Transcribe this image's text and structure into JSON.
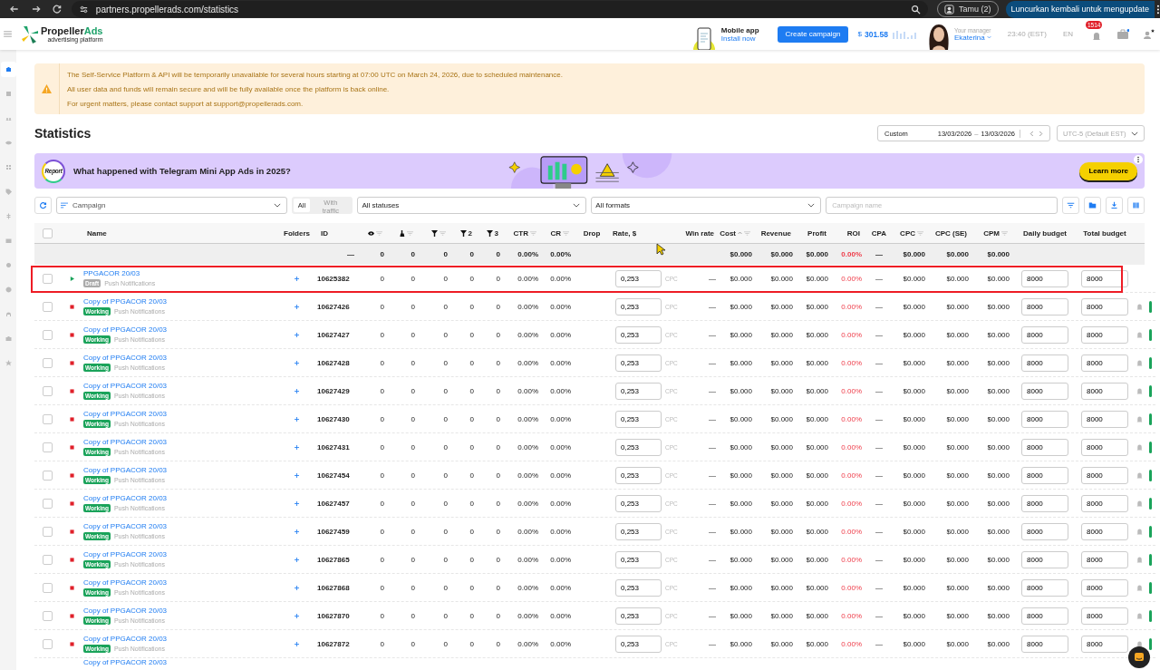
{
  "browser": {
    "url": "partners.propellerads.com/statistics",
    "profile": "Tamu (2)",
    "update_button": "Luncurkan kembali untuk mengupdate"
  },
  "header": {
    "logo_main": "Propeller",
    "logo_accent": "Ads",
    "logo_tagline": "advertising platform",
    "mobile_app_title": "Mobile app",
    "mobile_app_link": "Install now",
    "create_button": "Create campaign",
    "balance_currency": "$",
    "balance": "301.58",
    "manager_label": "Your manager",
    "manager_name": "Ekaterina",
    "time": "23:40 (EST)",
    "language": "EN",
    "notifications": "1514"
  },
  "sidebar": [
    {
      "selected": true
    },
    {
      "selected": false
    },
    {
      "selected": false
    },
    {
      "selected": false
    },
    {
      "selected": false
    },
    {
      "selected": false
    },
    {
      "selected": false
    },
    {
      "selected": false
    },
    {
      "selected": false
    },
    {
      "selected": false
    },
    {
      "selected": false
    },
    {
      "selected": false
    },
    {
      "selected": false
    }
  ],
  "notice": {
    "lines": [
      "The Self-Service Platform & API will be temporarily unavailable for several hours starting at 07:00 UTC on March 24, 2026, due to scheduled maintenance.",
      "All user data and funds will remain secure and will be fully available once the platform is back online.",
      "For urgent matters, please contact support at support@propellerads.com."
    ]
  },
  "page_title": "Statistics",
  "date_range": {
    "preset": "Custom",
    "from": "13/03/2026",
    "separator": "–",
    "to": "13/03/2026"
  },
  "timezone": "UTC-5 (Default EST)",
  "promo": {
    "badge": "Report",
    "title": "What happened with Telegram Mini App Ads in 2025?",
    "button": "Learn more"
  },
  "filters": {
    "grouping": "Campaign",
    "traffic": [
      {
        "label": "All",
        "selected": true
      },
      {
        "label": "With traffic",
        "selected": false
      }
    ],
    "status": "All statuses",
    "formats": "All formats",
    "search_placeholder": "Campaign name"
  },
  "table": {
    "select_all": {
      "checked": false
    },
    "columns": [
      {
        "label": "Name",
        "filter": false,
        "sorted": false
      },
      {
        "label": "Folders",
        "filter": false,
        "sorted": false
      },
      {
        "label": "ID",
        "filter": false,
        "sorted": false
      },
      {
        "filter": true,
        "sorted": false
      },
      {
        "filter": true,
        "sorted": false
      },
      {
        "filter": true,
        "sorted": false
      },
      {
        "label": "2",
        "filter": false,
        "sorted": false
      },
      {
        "label": "3",
        "filter": false,
        "sorted": false
      },
      {
        "label": "CTR",
        "filter": true,
        "sorted": false
      },
      {
        "label": "CR",
        "filter": true,
        "sorted": false
      },
      {
        "label": "Drop",
        "filter": false,
        "sorted": false
      },
      {
        "label": "Rate, $",
        "filter": false,
        "sorted": false
      },
      {
        "label": "Win rate",
        "filter": false,
        "sorted": false
      },
      {
        "label": "Cost",
        "filter": true,
        "sorted": true
      },
      {
        "label": "Revenue",
        "filter": false,
        "sorted": false
      },
      {
        "label": "Profit",
        "filter": false,
        "sorted": false
      },
      {
        "label": "ROI",
        "filter": false,
        "sorted": false
      },
      {
        "label": "CPA",
        "filter": false,
        "sorted": false
      },
      {
        "label": "CPC",
        "filter": true,
        "sorted": false
      },
      {
        "label": "CPC (SE)",
        "filter": false,
        "sorted": false
      },
      {
        "label": "CPM",
        "filter": true,
        "sorted": false
      },
      {
        "label": "Daily budget",
        "filter": false,
        "sorted": false
      },
      {
        "label": "Total budget",
        "filter": false,
        "sorted": false
      }
    ],
    "totals": {
      "id": "—",
      "metrics": [
        "0",
        "0",
        "0",
        "0",
        "0",
        "0.00%",
        "0.00%"
      ],
      "money": [
        "$0.000",
        "$0.000",
        "$0.000"
      ],
      "roi": "0.00%",
      "cpa": "—",
      "cpc": [
        "$0.000",
        "$0.000",
        "$0.000"
      ]
    },
    "rows": [
      {
        "kind": "draft",
        "checked": false,
        "highlighted": true,
        "name": "PPGACOR 20/03",
        "badge": "Draft",
        "format": "Push Notifications",
        "id": "10625382",
        "metrics": [
          "0",
          "0",
          "0",
          "0",
          "0",
          "0.00%",
          "0.00%"
        ],
        "rate": "0,253",
        "rate_unit": "CPC",
        "win_rate": "—",
        "money": [
          "$0.000",
          "$0.000",
          "$0.000"
        ],
        "roi": "0.00%",
        "cpa": "—",
        "cpc": [
          "$0.000",
          "$0.000",
          "$0.000"
        ],
        "daily_budget": "8000",
        "total_budget": "8000"
      },
      {
        "kind": "working",
        "checked": false,
        "highlighted": false,
        "name": "Copy of PPGACOR 20/03",
        "badge": "Working",
        "format": "Push Notifications",
        "id": "10627426",
        "metrics": [
          "0",
          "0",
          "0",
          "0",
          "0",
          "0.00%",
          "0.00%"
        ],
        "rate": "0,253",
        "rate_unit": "CPC",
        "win_rate": "—",
        "money": [
          "$0.000",
          "$0.000",
          "$0.000"
        ],
        "roi": "0.00%",
        "cpa": "—",
        "cpc": [
          "$0.000",
          "$0.000",
          "$0.000"
        ],
        "daily_budget": "8000",
        "total_budget": "8000"
      },
      {
        "kind": "working",
        "checked": false,
        "highlighted": false,
        "name": "Copy of PPGACOR 20/03",
        "badge": "Working",
        "format": "Push Notifications",
        "id": "10627427",
        "metrics": [
          "0",
          "0",
          "0",
          "0",
          "0",
          "0.00%",
          "0.00%"
        ],
        "rate": "0,253",
        "rate_unit": "CPC",
        "win_rate": "—",
        "money": [
          "$0.000",
          "$0.000",
          "$0.000"
        ],
        "roi": "0.00%",
        "cpa": "—",
        "cpc": [
          "$0.000",
          "$0.000",
          "$0.000"
        ],
        "daily_budget": "8000",
        "total_budget": "8000"
      },
      {
        "kind": "working",
        "checked": false,
        "highlighted": false,
        "name": "Copy of PPGACOR 20/03",
        "badge": "Working",
        "format": "Push Notifications",
        "id": "10627428",
        "metrics": [
          "0",
          "0",
          "0",
          "0",
          "0",
          "0.00%",
          "0.00%"
        ],
        "rate": "0,253",
        "rate_unit": "CPC",
        "win_rate": "—",
        "money": [
          "$0.000",
          "$0.000",
          "$0.000"
        ],
        "roi": "0.00%",
        "cpa": "—",
        "cpc": [
          "$0.000",
          "$0.000",
          "$0.000"
        ],
        "daily_budget": "8000",
        "total_budget": "8000"
      },
      {
        "kind": "working",
        "checked": false,
        "highlighted": false,
        "name": "Copy of PPGACOR 20/03",
        "badge": "Working",
        "format": "Push Notifications",
        "id": "10627429",
        "metrics": [
          "0",
          "0",
          "0",
          "0",
          "0",
          "0.00%",
          "0.00%"
        ],
        "rate": "0,253",
        "rate_unit": "CPC",
        "win_rate": "—",
        "money": [
          "$0.000",
          "$0.000",
          "$0.000"
        ],
        "roi": "0.00%",
        "cpa": "—",
        "cpc": [
          "$0.000",
          "$0.000",
          "$0.000"
        ],
        "daily_budget": "8000",
        "total_budget": "8000"
      },
      {
        "kind": "working",
        "checked": false,
        "highlighted": false,
        "name": "Copy of PPGACOR 20/03",
        "badge": "Working",
        "format": "Push Notifications",
        "id": "10627430",
        "metrics": [
          "0",
          "0",
          "0",
          "0",
          "0",
          "0.00%",
          "0.00%"
        ],
        "rate": "0,253",
        "rate_unit": "CPC",
        "win_rate": "—",
        "money": [
          "$0.000",
          "$0.000",
          "$0.000"
        ],
        "roi": "0.00%",
        "cpa": "—",
        "cpc": [
          "$0.000",
          "$0.000",
          "$0.000"
        ],
        "daily_budget": "8000",
        "total_budget": "8000"
      },
      {
        "kind": "working",
        "checked": false,
        "highlighted": false,
        "name": "Copy of PPGACOR 20/03",
        "badge": "Working",
        "format": "Push Notifications",
        "id": "10627431",
        "metrics": [
          "0",
          "0",
          "0",
          "0",
          "0",
          "0.00%",
          "0.00%"
        ],
        "rate": "0,253",
        "rate_unit": "CPC",
        "win_rate": "—",
        "money": [
          "$0.000",
          "$0.000",
          "$0.000"
        ],
        "roi": "0.00%",
        "cpa": "—",
        "cpc": [
          "$0.000",
          "$0.000",
          "$0.000"
        ],
        "daily_budget": "8000",
        "total_budget": "8000"
      },
      {
        "kind": "working",
        "checked": false,
        "highlighted": false,
        "name": "Copy of PPGACOR 20/03",
        "badge": "Working",
        "format": "Push Notifications",
        "id": "10627454",
        "metrics": [
          "0",
          "0",
          "0",
          "0",
          "0",
          "0.00%",
          "0.00%"
        ],
        "rate": "0,253",
        "rate_unit": "CPC",
        "win_rate": "—",
        "money": [
          "$0.000",
          "$0.000",
          "$0.000"
        ],
        "roi": "0.00%",
        "cpa": "—",
        "cpc": [
          "$0.000",
          "$0.000",
          "$0.000"
        ],
        "daily_budget": "8000",
        "total_budget": "8000"
      },
      {
        "kind": "working",
        "checked": false,
        "highlighted": false,
        "name": "Copy of PPGACOR 20/03",
        "badge": "Working",
        "format": "Push Notifications",
        "id": "10627457",
        "metrics": [
          "0",
          "0",
          "0",
          "0",
          "0",
          "0.00%",
          "0.00%"
        ],
        "rate": "0,253",
        "rate_unit": "CPC",
        "win_rate": "—",
        "money": [
          "$0.000",
          "$0.000",
          "$0.000"
        ],
        "roi": "0.00%",
        "cpa": "—",
        "cpc": [
          "$0.000",
          "$0.000",
          "$0.000"
        ],
        "daily_budget": "8000",
        "total_budget": "8000"
      },
      {
        "kind": "working",
        "checked": false,
        "highlighted": false,
        "name": "Copy of PPGACOR 20/03",
        "badge": "Working",
        "format": "Push Notifications",
        "id": "10627459",
        "metrics": [
          "0",
          "0",
          "0",
          "0",
          "0",
          "0.00%",
          "0.00%"
        ],
        "rate": "0,253",
        "rate_unit": "CPC",
        "win_rate": "—",
        "money": [
          "$0.000",
          "$0.000",
          "$0.000"
        ],
        "roi": "0.00%",
        "cpa": "—",
        "cpc": [
          "$0.000",
          "$0.000",
          "$0.000"
        ],
        "daily_budget": "8000",
        "total_budget": "8000"
      },
      {
        "kind": "working",
        "checked": false,
        "highlighted": false,
        "name": "Copy of PPGACOR 20/03",
        "badge": "Working",
        "format": "Push Notifications",
        "id": "10627865",
        "metrics": [
          "0",
          "0",
          "0",
          "0",
          "0",
          "0.00%",
          "0.00%"
        ],
        "rate": "0,253",
        "rate_unit": "CPC",
        "win_rate": "—",
        "money": [
          "$0.000",
          "$0.000",
          "$0.000"
        ],
        "roi": "0.00%",
        "cpa": "—",
        "cpc": [
          "$0.000",
          "$0.000",
          "$0.000"
        ],
        "daily_budget": "8000",
        "total_budget": "8000"
      },
      {
        "kind": "working",
        "checked": false,
        "highlighted": false,
        "name": "Copy of PPGACOR 20/03",
        "badge": "Working",
        "format": "Push Notifications",
        "id": "10627868",
        "metrics": [
          "0",
          "0",
          "0",
          "0",
          "0",
          "0.00%",
          "0.00%"
        ],
        "rate": "0,253",
        "rate_unit": "CPC",
        "win_rate": "—",
        "money": [
          "$0.000",
          "$0.000",
          "$0.000"
        ],
        "roi": "0.00%",
        "cpa": "—",
        "cpc": [
          "$0.000",
          "$0.000",
          "$0.000"
        ],
        "daily_budget": "8000",
        "total_budget": "8000"
      },
      {
        "kind": "working",
        "checked": false,
        "highlighted": false,
        "name": "Copy of PPGACOR 20/03",
        "badge": "Working",
        "format": "Push Notifications",
        "id": "10627870",
        "metrics": [
          "0",
          "0",
          "0",
          "0",
          "0",
          "0.00%",
          "0.00%"
        ],
        "rate": "0,253",
        "rate_unit": "CPC",
        "win_rate": "—",
        "money": [
          "$0.000",
          "$0.000",
          "$0.000"
        ],
        "roi": "0.00%",
        "cpa": "—",
        "cpc": [
          "$0.000",
          "$0.000",
          "$0.000"
        ],
        "daily_budget": "8000",
        "total_budget": "8000"
      },
      {
        "kind": "working",
        "checked": false,
        "highlighted": false,
        "name": "Copy of PPGACOR 20/03",
        "badge": "Working",
        "format": "Push Notifications",
        "id": "10627872",
        "metrics": [
          "0",
          "0",
          "0",
          "0",
          "0",
          "0.00%",
          "0.00%"
        ],
        "rate": "0,253",
        "rate_unit": "CPC",
        "win_rate": "—",
        "money": [
          "$0.000",
          "$0.000",
          "$0.000"
        ],
        "roi": "0.00%",
        "cpa": "—",
        "cpc": [
          "$0.000",
          "$0.000",
          "$0.000"
        ],
        "daily_budget": "8000",
        "total_budget": "8000"
      },
      {
        "kind": "partial",
        "name": "Copy of PPGACOR 20/03"
      }
    ]
  }
}
